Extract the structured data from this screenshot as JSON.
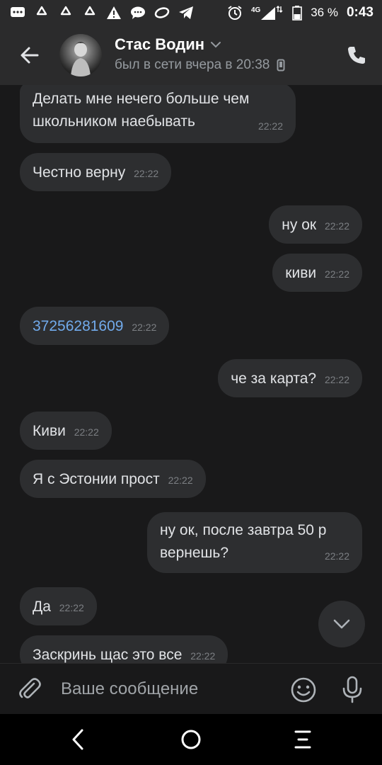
{
  "status_bar": {
    "battery_percent": "36 %",
    "time": "0:43",
    "network": "4G"
  },
  "header": {
    "contact_name": "Стас Водин",
    "last_seen": "был в сети вчера в 20:38"
  },
  "messages": [
    {
      "direction": "in",
      "text": "Делать мне нечего больше чем школьником наебывать",
      "time": "22:22"
    },
    {
      "direction": "in",
      "text": "Честно верну",
      "time": "22:22"
    },
    {
      "direction": "out",
      "text": "ну ок",
      "time": "22:22"
    },
    {
      "direction": "out",
      "text": "киви",
      "time": "22:22"
    },
    {
      "direction": "in",
      "text": "37256281609",
      "time": "22:22",
      "is_link": true
    },
    {
      "direction": "out",
      "text": "че за карта?",
      "time": "22:22"
    },
    {
      "direction": "in",
      "text": "Киви",
      "time": "22:22"
    },
    {
      "direction": "in",
      "text": "Я с Эстонии прост",
      "time": "22:22"
    },
    {
      "direction": "out",
      "text": "ну ок, после завтра 50 р вернешь?",
      "time": "22:22"
    },
    {
      "direction": "in",
      "text": "Да",
      "time": "22:22"
    },
    {
      "direction": "in",
      "text": "Заскринь щас это все",
      "time": "22:22"
    }
  ],
  "composer": {
    "placeholder": "Ваше сообщение"
  },
  "colors": {
    "background": "#19191a",
    "header": "#2b2b2c",
    "bubble": "#2d2e30",
    "link": "#71aaeb",
    "text": "#e1e3e6",
    "muted": "#7c7f83"
  }
}
